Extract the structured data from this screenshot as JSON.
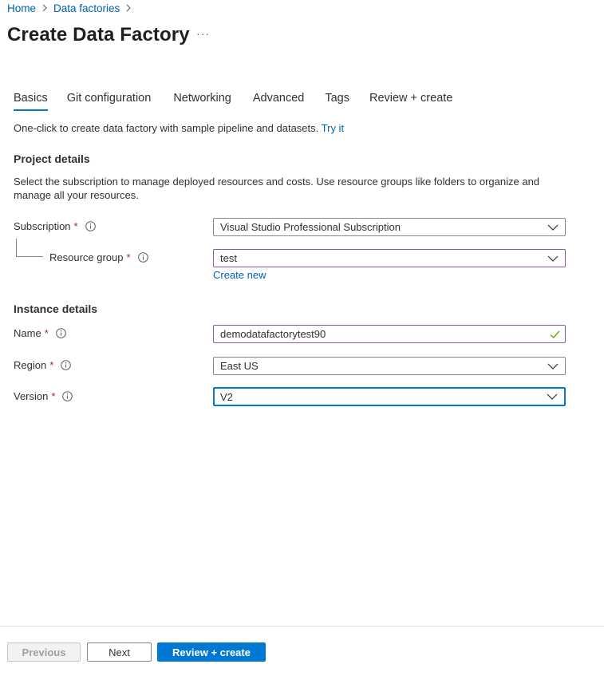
{
  "breadcrumb": {
    "items": [
      {
        "label": "Home"
      },
      {
        "label": "Data factories"
      }
    ]
  },
  "page": {
    "title": "Create Data Factory",
    "more_label": "···"
  },
  "tabs": [
    {
      "label": "Basics",
      "active": true
    },
    {
      "label": "Git configuration"
    },
    {
      "label": "Networking"
    },
    {
      "label": "Advanced"
    },
    {
      "label": "Tags"
    },
    {
      "label": "Review + create"
    }
  ],
  "intro": {
    "text": "One-click to create data factory with sample pipeline and datasets.",
    "link": "Try it"
  },
  "project_details": {
    "heading": "Project details",
    "description": "Select the subscription to manage deployed resources and costs. Use resource groups like folders to organize and manage all your resources.",
    "subscription": {
      "label": "Subscription",
      "required_mark": "*",
      "value": "Visual Studio Professional Subscription"
    },
    "resource_group": {
      "label": "Resource group",
      "required_mark": "*",
      "value": "test",
      "create_new": "Create new"
    }
  },
  "instance_details": {
    "heading": "Instance details",
    "name": {
      "label": "Name",
      "required_mark": "*",
      "value": "demodatafactorytest90"
    },
    "region": {
      "label": "Region",
      "required_mark": "*",
      "value": "East US"
    },
    "version": {
      "label": "Version",
      "required_mark": "*",
      "value": "V2"
    }
  },
  "footer": {
    "previous": "Previous",
    "next": "Next",
    "review_create": "Review + create"
  },
  "colors": {
    "accent": "#0078d4",
    "link": "#0062ad",
    "required": "#a4262c",
    "valid_check": "#57a300",
    "validated_border": "#8a5a9e"
  },
  "icons": {
    "breadcrumb_separator": "chevron-right-icon",
    "info": "info-icon",
    "dropdown": "chevron-down-icon",
    "valid": "checkmark-icon"
  }
}
